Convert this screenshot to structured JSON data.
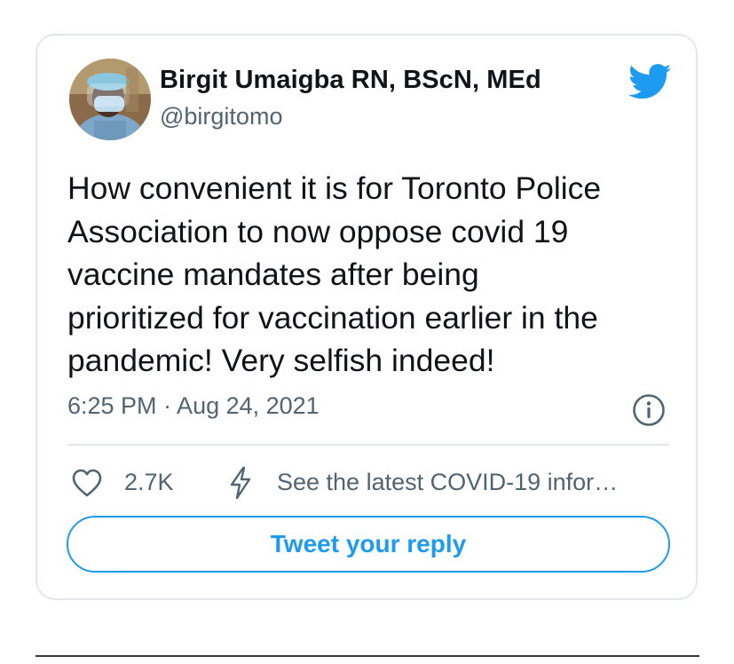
{
  "author": {
    "name": "Birgit Umaigba RN, BScN, MEd",
    "handle": "@birgitomo"
  },
  "tweet": {
    "text": "How convenient it is for Toronto Police\nAssociation to now oppose covid 19\nvaccine mandates after being\nprioritized for vaccination earlier in the\npandemic! Very selfish indeed!",
    "timestamp": "6:25 PM · Aug 24, 2021"
  },
  "actions": {
    "like_count": "2.7K",
    "covid_info": "See the latest COVID-19 infor…",
    "reply_label": "Tweet your reply"
  },
  "icons": {
    "brand": "twitter-bird-icon",
    "info": "info-icon",
    "like": "heart-icon",
    "covid": "lightning-bolt-icon"
  },
  "colors": {
    "accent": "#1d9bf0",
    "text": "#0f1419",
    "muted": "#536471",
    "border": "#e1e8ed"
  }
}
